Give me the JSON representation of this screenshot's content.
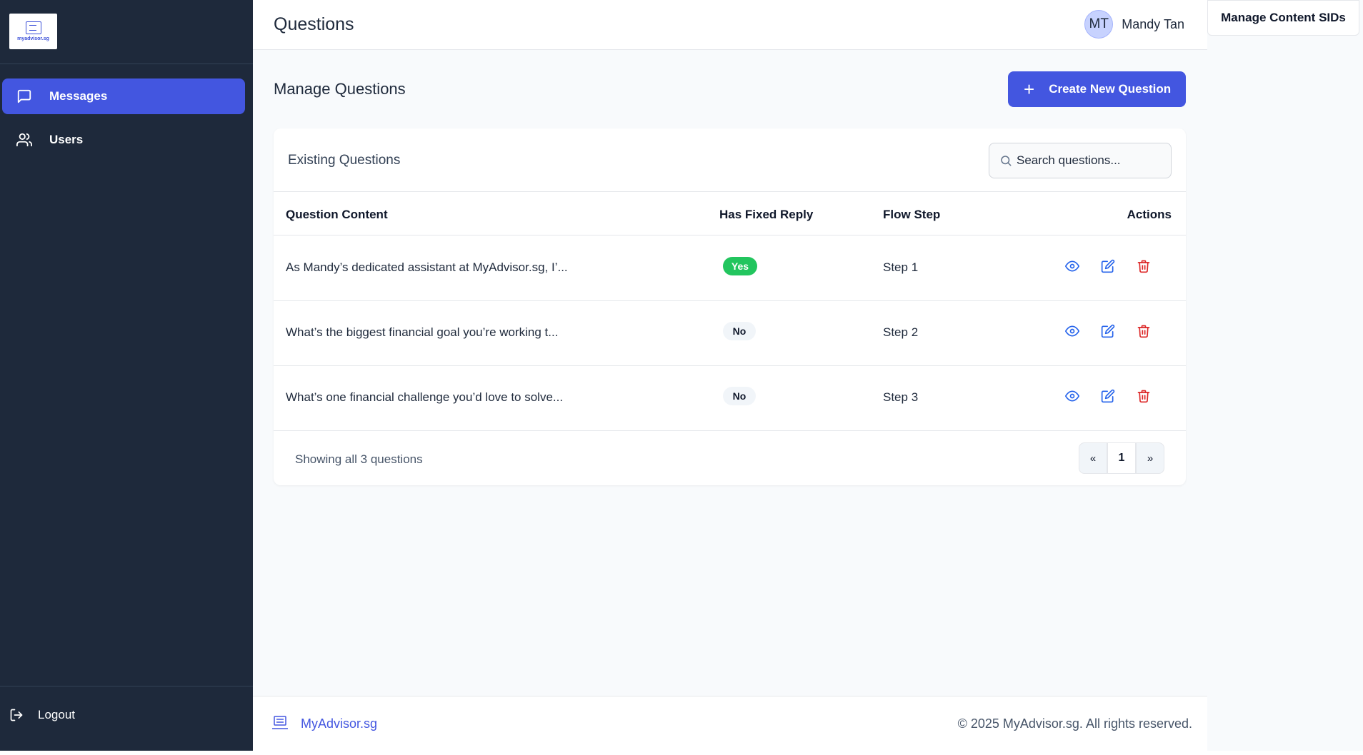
{
  "sidebar": {
    "logo_text": "myadvisor.sg",
    "items": [
      {
        "label": "Messages",
        "icon": "message-square-icon",
        "active": true
      },
      {
        "label": "Users",
        "icon": "users-icon",
        "active": false
      }
    ],
    "logout_label": "Logout"
  },
  "header": {
    "title": "Questions",
    "user_initials": "MT",
    "user_name": "Mandy Tan"
  },
  "right_panel": {
    "manage_sids_label": "Manage Content SIDs"
  },
  "main": {
    "section_title": "Manage Questions",
    "create_button_label": "Create New Question",
    "card_title": "Existing Questions",
    "search_placeholder": "Search questions...",
    "columns": [
      "Question Content",
      "Has Fixed Reply",
      "Flow Step",
      "Actions"
    ],
    "rows": [
      {
        "content": "As Mandy’s dedicated assistant at MyAdvisor.sg, I’...",
        "fixed_reply": "Yes",
        "flow_step": "Step 1"
      },
      {
        "content": "What’s the biggest financial goal you’re working t...",
        "fixed_reply": "No",
        "flow_step": "Step 2"
      },
      {
        "content": "What’s one financial challenge you’d love to solve...",
        "fixed_reply": "No",
        "flow_step": "Step 3"
      }
    ],
    "showing_text": "Showing all 3 questions",
    "pagination": {
      "prev": "«",
      "current": "1",
      "next": "»"
    }
  },
  "footer": {
    "brand": "MyAdvisor.sg",
    "copyright": "© 2025 MyAdvisor.sg. All rights reserved."
  },
  "colors": {
    "sidebar_bg": "#1e293b",
    "accent": "#4356e0",
    "yes_badge": "#22c55e",
    "view_icon": "#2563eb",
    "delete_icon": "#dc2626"
  }
}
